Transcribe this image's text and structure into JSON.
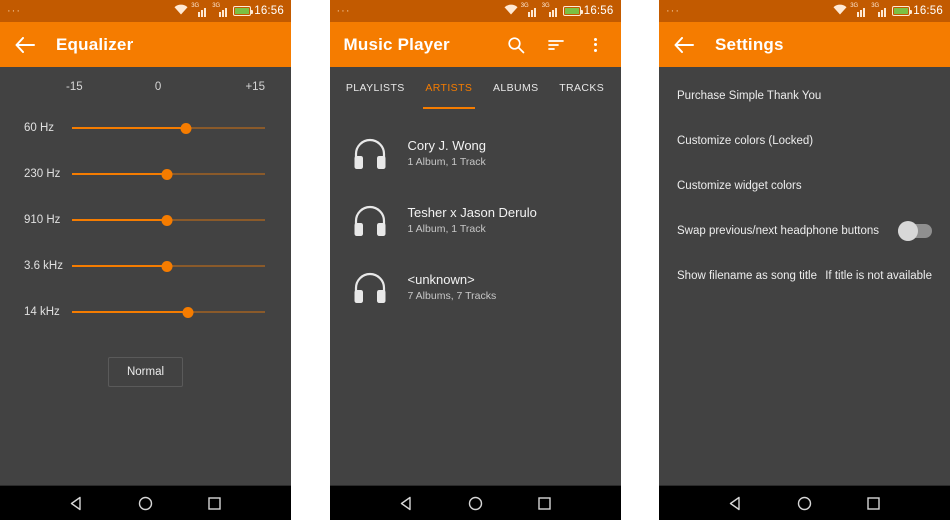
{
  "statusbar": {
    "dots": "···",
    "time": "16:56",
    "wifi_icon": "wifi-icon",
    "signal1_icon": "signal-3g-icon",
    "signal2_icon": "signal-3g-icon",
    "signal_label": "3G",
    "battery_icon": "battery-charging-icon"
  },
  "navbar": {
    "back_icon": "nav-back-triangle-icon",
    "home_icon": "nav-home-circle-icon",
    "recents_icon": "nav-recents-square-icon"
  },
  "colors": {
    "accent": "#f57c00",
    "statusbar": "#c25a00",
    "background": "#424242",
    "navbar": "#000000",
    "battery_green": "#7cc142"
  },
  "equalizer": {
    "appbar": {
      "back_icon": "back-arrow-icon",
      "title": "Equalizer"
    },
    "scale": {
      "min": "-15",
      "mid": "0",
      "max": "+15"
    },
    "bands": [
      {
        "label": "60 Hz",
        "value_pct": 59
      },
      {
        "label": "230 Hz",
        "value_pct": 49
      },
      {
        "label": "910 Hz",
        "value_pct": 49
      },
      {
        "label": "3.6 kHz",
        "value_pct": 49
      },
      {
        "label": "14 kHz",
        "value_pct": 60
      }
    ],
    "preset_button": "Normal"
  },
  "music_player": {
    "appbar": {
      "title": "Music Player",
      "search_icon": "search-icon",
      "sort_icon": "sort-icon",
      "overflow_icon": "overflow-menu-icon"
    },
    "tabs": [
      {
        "label": "PLAYLISTS",
        "active": false
      },
      {
        "label": "ARTISTS",
        "active": true
      },
      {
        "label": "ALBUMS",
        "active": false
      },
      {
        "label": "TRACKS",
        "active": false
      }
    ],
    "artists": [
      {
        "icon": "headphones-icon",
        "name": "Cory J. Wong",
        "detail": "1 Album, 1 Track"
      },
      {
        "icon": "headphones-icon",
        "name": "Tesher x Jason Derulo",
        "detail": "1 Album, 1 Track"
      },
      {
        "icon": "headphones-icon",
        "name": "<unknown>",
        "detail": "7 Albums, 7 Tracks"
      }
    ]
  },
  "settings": {
    "appbar": {
      "back_icon": "back-arrow-icon",
      "title": "Settings"
    },
    "rows": [
      {
        "label": "Purchase Simple Thank You",
        "value": "",
        "type": "plain"
      },
      {
        "label": "Customize colors (Locked)",
        "value": "",
        "type": "plain"
      },
      {
        "label": "Customize widget colors",
        "value": "",
        "type": "plain"
      },
      {
        "label": "Swap previous/next headphone buttons",
        "value": "",
        "type": "switch",
        "checked": false
      },
      {
        "label": "Show filename as song title",
        "value": "If title is not available",
        "type": "value"
      }
    ]
  }
}
